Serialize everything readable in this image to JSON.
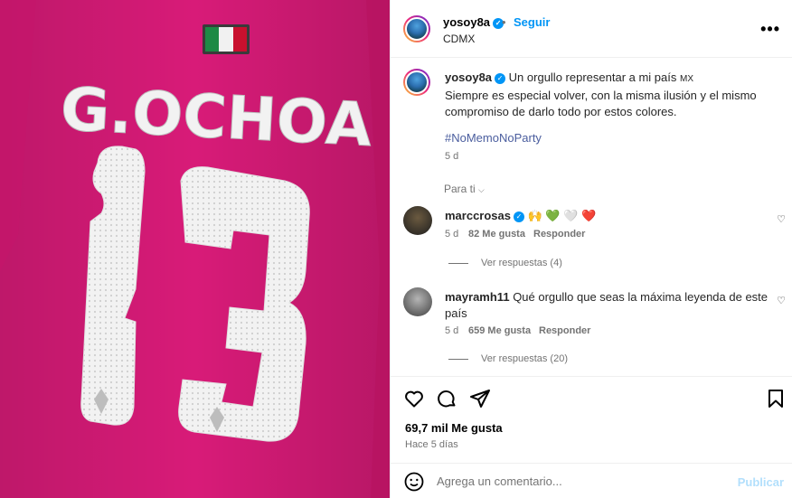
{
  "post": {
    "jersey_name": "G.OCHOA",
    "jersey_number": "13"
  },
  "header": {
    "username": "yosoy8a",
    "dot": "•",
    "follow_label": "Seguir",
    "location": "CDMX",
    "more_label": "•••"
  },
  "caption": {
    "username": "yosoy8a",
    "line1": "Un orgullo representar a mi país",
    "flag": "MX",
    "line2": "Siempre es especial volver, con la misma ilusión y el mismo compromiso de darlo todo por estos colores.",
    "hashtag": "#NoMemoNoParty",
    "time": "5 d",
    "translate": "Para ti"
  },
  "comments": [
    {
      "username": "marccrosas",
      "text": "🙌 💚 🤍 ❤️",
      "time": "5 d",
      "likes": "82 Me gusta",
      "reply_label": "Responder",
      "view_replies": "Ver respuestas (4)"
    },
    {
      "username": "mayramh11",
      "text": "Qué orgullo que seas la máxima leyenda de este país",
      "time": "5 d",
      "likes": "659 Me gusta",
      "reply_label": "Responder",
      "view_replies": "Ver respuestas (20)"
    }
  ],
  "actions": {
    "likes": "69,7 mil Me gusta",
    "ago": "Hace 5 días"
  },
  "comment_box": {
    "placeholder": "Agrega un comentario...",
    "post_label": "Publicar"
  },
  "colors": {
    "jersey": "#d81b78",
    "accent": "#0095f6",
    "post_button": "#b2dffc"
  }
}
